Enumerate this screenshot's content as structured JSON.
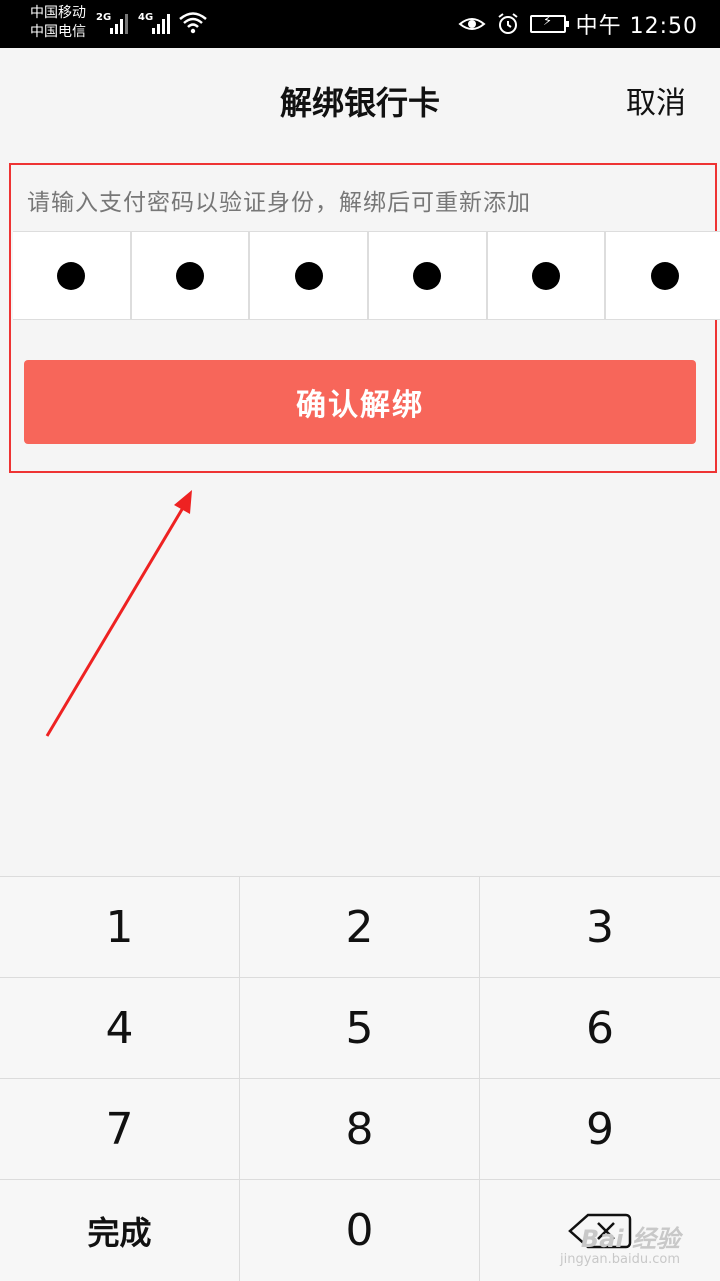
{
  "status_bar": {
    "carrier_1": "中国移动",
    "carrier_2": "中国电信",
    "network_1": "2G",
    "network_2": "4G",
    "time": "中午 12:50"
  },
  "header": {
    "title": "解绑银行卡",
    "cancel_label": "取消"
  },
  "verify": {
    "hint": "请输入支付密码以验证身份，解绑后可重新添加",
    "pin_digits_entered": 6,
    "pin_length": 6,
    "confirm_label": "确认解绑"
  },
  "keypad": {
    "keys": [
      "1",
      "2",
      "3",
      "4",
      "5",
      "6",
      "7",
      "8",
      "9",
      "完成",
      "0",
      ""
    ]
  },
  "watermark": {
    "main": "Bai 经验",
    "sub": "jingyan.baidu.com"
  },
  "colors": {
    "accent": "#f7665a",
    "highlight_border": "#ee3333",
    "annotation_arrow": "#ee2222"
  }
}
